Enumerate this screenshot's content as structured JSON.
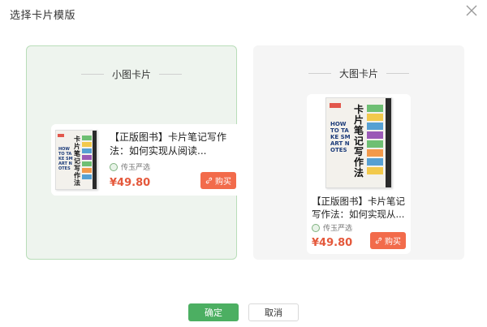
{
  "dialog": {
    "title": "选择卡片模版"
  },
  "options": {
    "small": {
      "label": "小图卡片",
      "selected": true
    },
    "large": {
      "label": "大图卡片",
      "selected": false
    }
  },
  "product": {
    "title": "【正版图书】卡片笔记写作法：如何实现从阅读...",
    "title_large": "【正版图书】卡片笔记写作法：如何实现从...",
    "shop": "传玉严选",
    "price": "¥49.80",
    "buy_label": "购买",
    "cover": {
      "cn_title": "卡片笔记写作法",
      "en_title": "HOW TO TAKE SMART NOTES"
    }
  },
  "footer": {
    "confirm_label": "确定",
    "cancel_label": "取消"
  },
  "colors": {
    "accent_green": "#4caf62",
    "buy_orange": "#f26b4b",
    "price_red": "#e4583b"
  }
}
